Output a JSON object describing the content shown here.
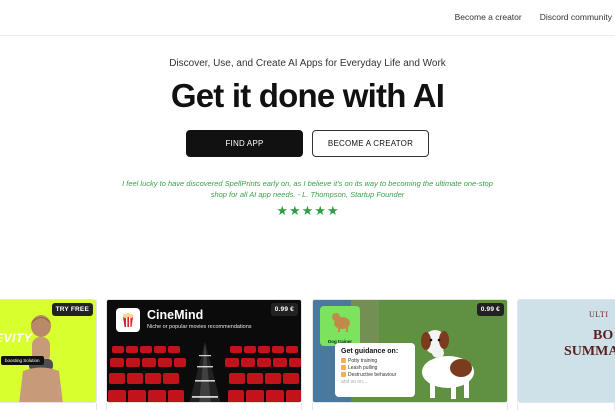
{
  "nav": {
    "links": [
      "Become a creator",
      "Discord community"
    ]
  },
  "hero": {
    "subtitle": "Discover, Use, and Create AI Apps for Everyday Life and Work",
    "headline": "Get it done with AI",
    "primary_button": "FIND APP",
    "secondary_button": "BECOME A CREATOR",
    "quote": "I feel lucky to have discovered SpellPrints early on, as I believe it's on its way to becoming the ultimate one-stop shop for all AI app needs. - L. Thompson, Startup Founder",
    "stars": 5
  },
  "cards": [
    {
      "badge": "TRY FREE",
      "promo_word": "EVITY",
      "promo_tag": "boosting Solution",
      "bg_color": "#d8ff2e"
    },
    {
      "title": "CineMind",
      "description": "Niche or popular movies recommendations",
      "price": "0.99 €",
      "bg_color": "#0b0b0b"
    },
    {
      "badge_label": "Dog trainer",
      "guide_title": "Get guidance on:",
      "guide_items": [
        "Potty training",
        "Leash pulling",
        "Destructive behaviour",
        "and so on..."
      ],
      "price": "0.99 €",
      "bg_color": "#5a8a3b"
    },
    {
      "line1": "ULTI",
      "line2": "BO",
      "line3": "SUMMA",
      "bg_color": "#cfe1e8"
    }
  ],
  "colors": {
    "accent_green": "#2e9e44",
    "quote_green": "#3aa24a",
    "primary_button_bg": "#111111"
  }
}
